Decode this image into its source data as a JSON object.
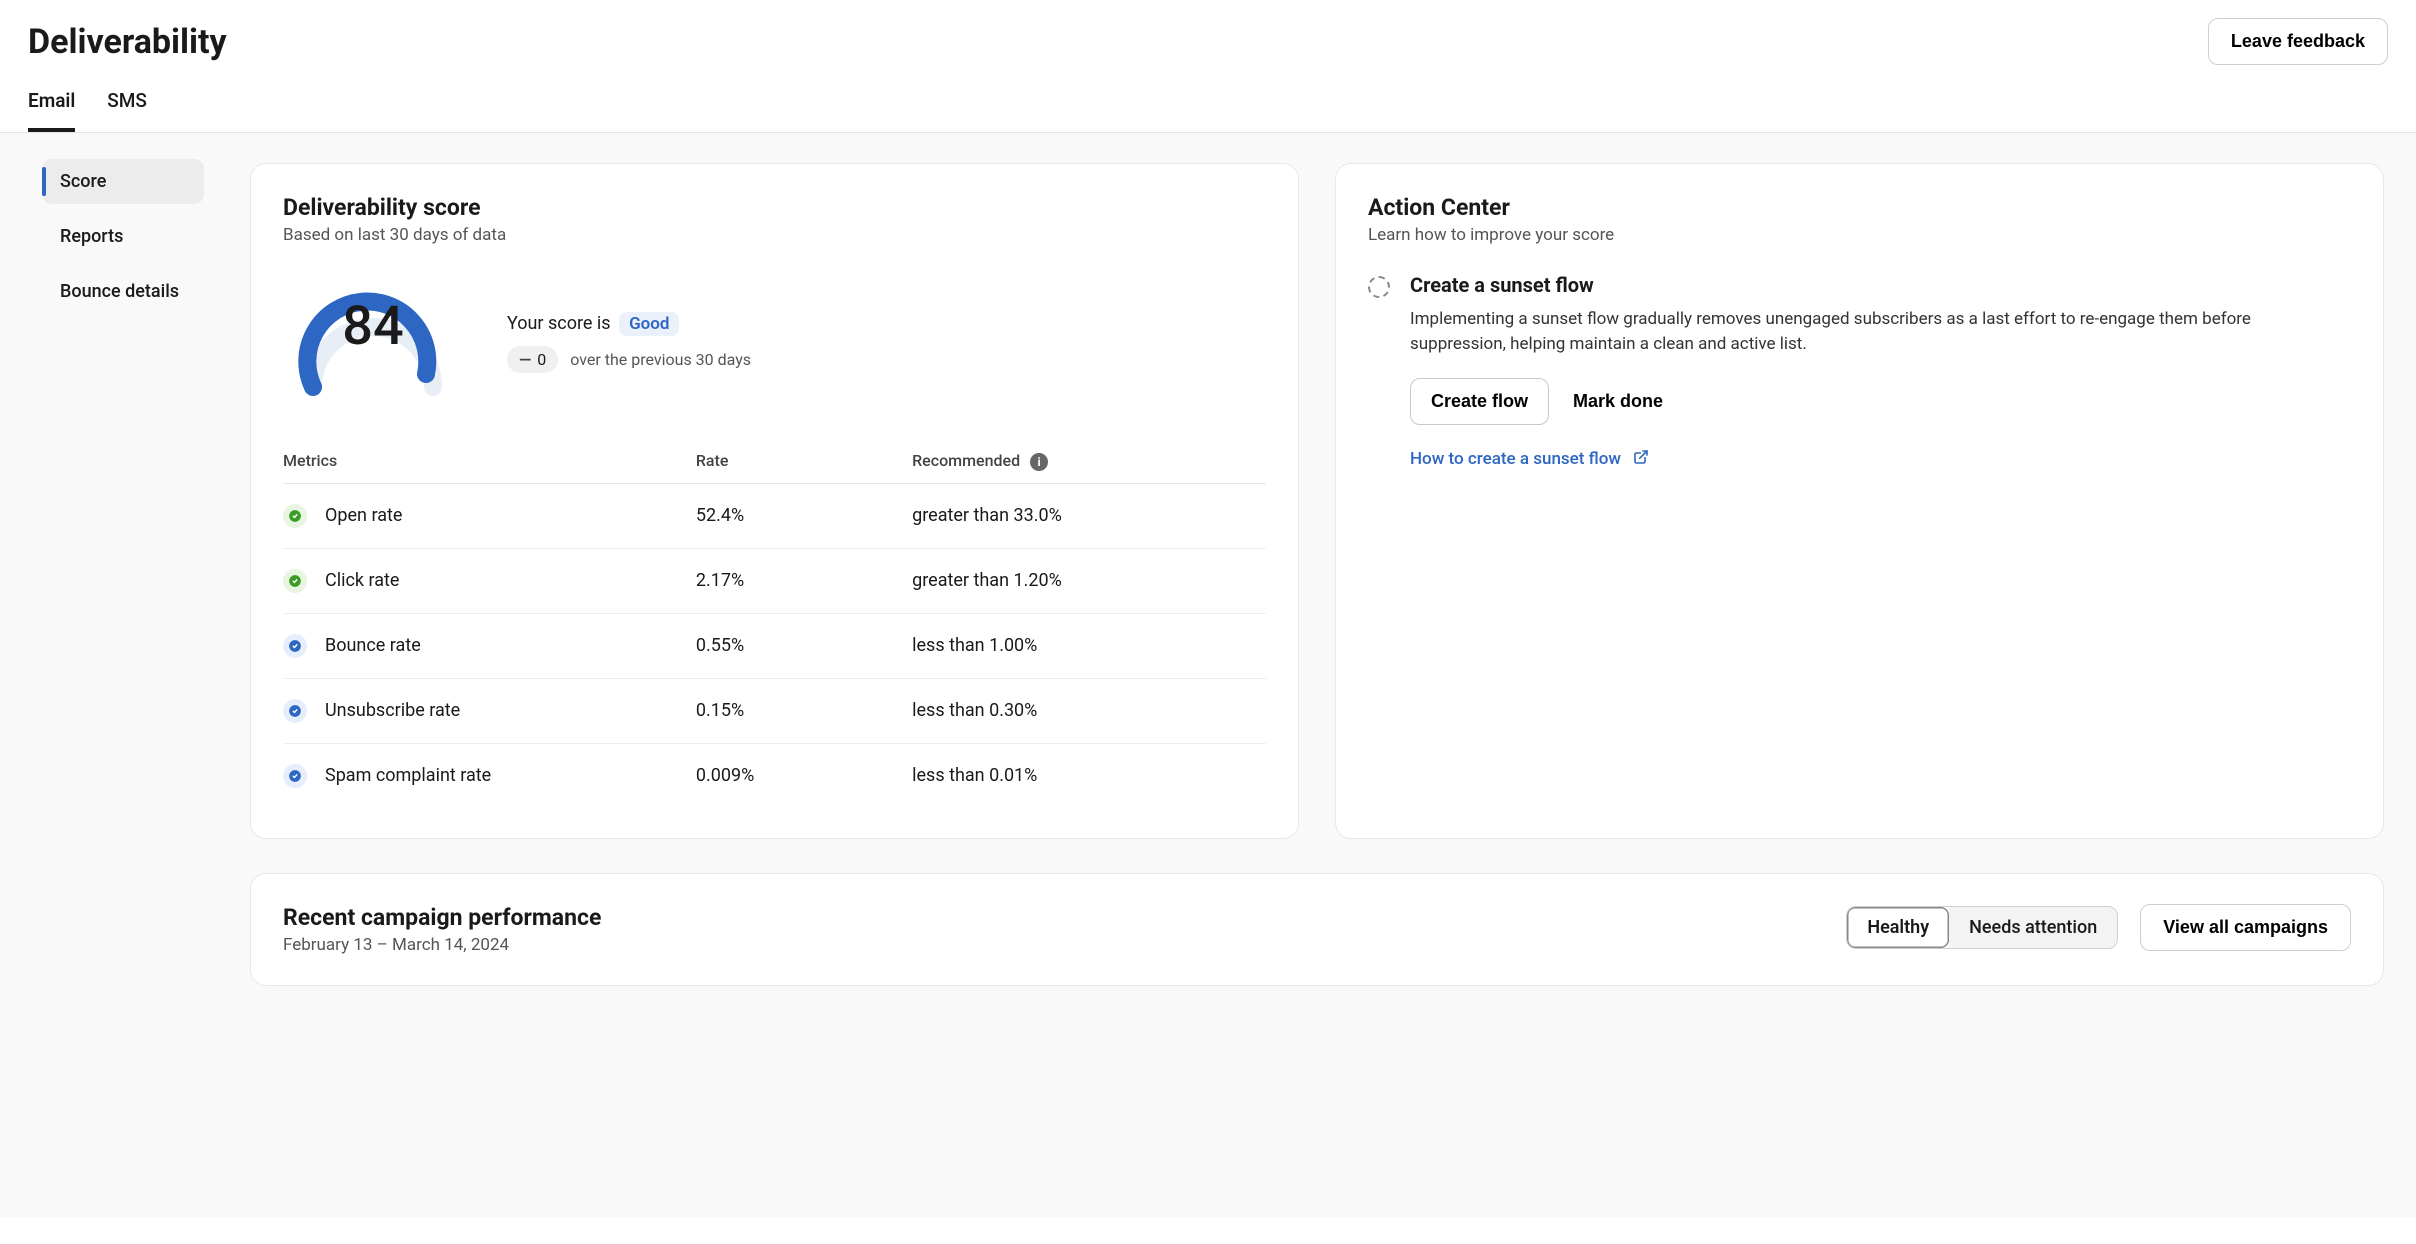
{
  "header": {
    "title": "Deliverability",
    "feedback_label": "Leave feedback"
  },
  "tabs": {
    "email": "Email",
    "sms": "SMS"
  },
  "sidebar": {
    "items": [
      {
        "label": "Score"
      },
      {
        "label": "Reports"
      },
      {
        "label": "Bounce details"
      }
    ]
  },
  "score_card": {
    "title": "Deliverability score",
    "subtitle": "Based on last 30 days of data",
    "score_number": "84",
    "score_text_prefix": "Your score is",
    "score_badge": "Good",
    "delta_value": "0",
    "delta_suffix": "over the previous 30 days",
    "table_headers": {
      "metrics": "Metrics",
      "rate": "Rate",
      "recommended": "Recommended"
    },
    "metrics": [
      {
        "status": "green",
        "name": "Open rate",
        "rate": "52.4%",
        "recommended": "greater than 33.0%"
      },
      {
        "status": "green",
        "name": "Click rate",
        "rate": "2.17%",
        "recommended": "greater than 1.20%"
      },
      {
        "status": "blue",
        "name": "Bounce rate",
        "rate": "0.55%",
        "recommended": "less than 1.00%"
      },
      {
        "status": "blue",
        "name": "Unsubscribe rate",
        "rate": "0.15%",
        "recommended": "less than 0.30%"
      },
      {
        "status": "blue",
        "name": "Spam complaint rate",
        "rate": "0.009%",
        "recommended": "less than 0.01%"
      }
    ]
  },
  "action_center": {
    "title": "Action Center",
    "subtitle": "Learn how to improve your score",
    "item_title": "Create a sunset flow",
    "item_desc": "Implementing a sunset flow gradually removes unengaged subscribers as a last effort to re-engage them before suppression, helping maintain a clean and active list.",
    "create_flow_label": "Create flow",
    "mark_done_label": "Mark done",
    "help_link": "How to create a sunset flow"
  },
  "recent": {
    "title": "Recent campaign performance",
    "date_range": "February 13 – March 14, 2024",
    "seg_healthy": "Healthy",
    "seg_needs": "Needs attention",
    "view_all_label": "View all campaigns"
  },
  "chart_data": {
    "type": "gauge",
    "title": "Deliverability score",
    "value": 84,
    "min": 0,
    "max": 100,
    "status_label": "Good",
    "delta": 0,
    "delta_period_days": 30
  }
}
